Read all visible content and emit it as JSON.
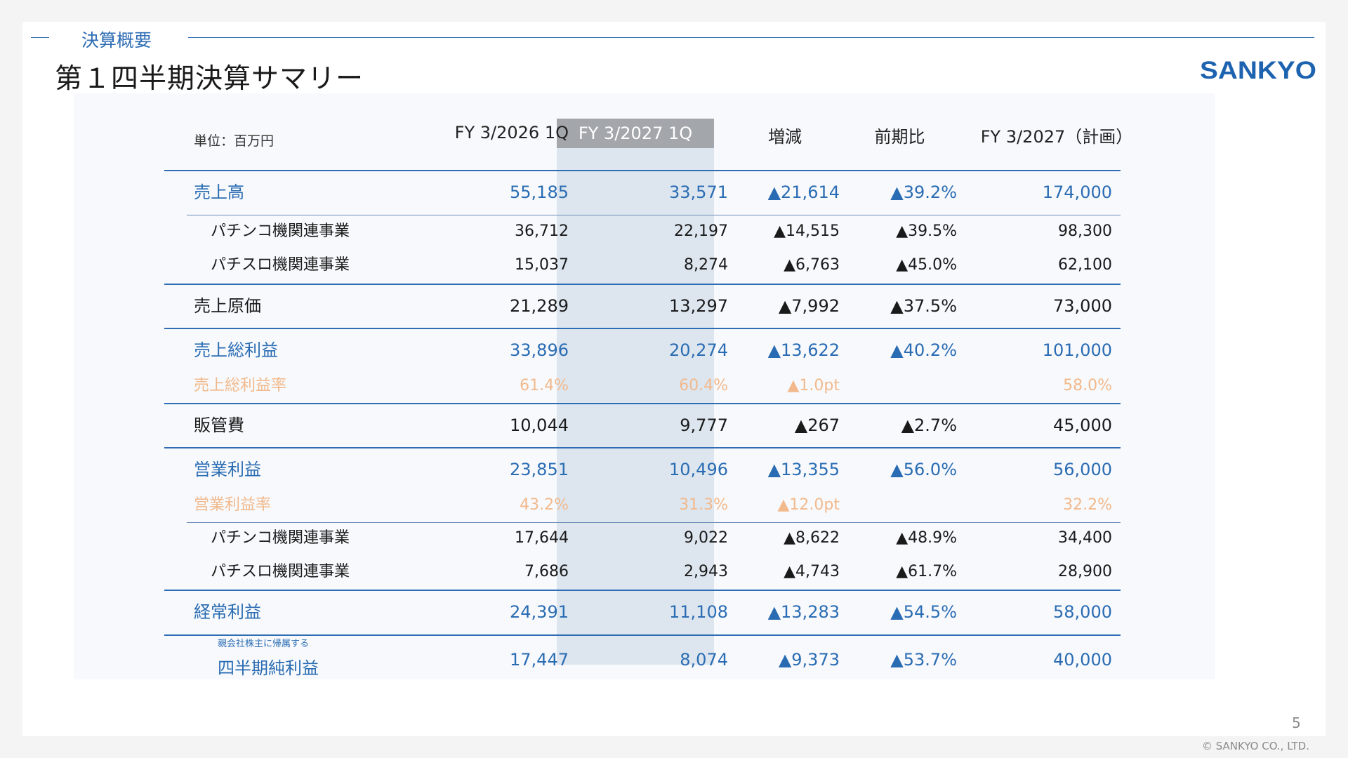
{
  "section_label": "決算概要",
  "page_title": "第１四半期決算サマリー",
  "logo_text": "SANKYO",
  "unit_label": "単位：百万円",
  "columns": [
    "FY 3/2026 1Q",
    "FY 3/2027 1Q",
    "増減",
    "前期比",
    "FY 3/2027（計画）"
  ],
  "rows": [
    {
      "label": "売上高",
      "c1": "55,185",
      "c2": "33,571",
      "c3": "▲21,614",
      "c4": "▲39.2%",
      "c5": "174,000"
    },
    {
      "label": "パチンコ機関連事業",
      "c1": "36,712",
      "c2": "22,197",
      "c3": "▲14,515",
      "c4": "▲39.5%",
      "c5": "98,300"
    },
    {
      "label": "パチスロ機関連事業",
      "c1": "15,037",
      "c2": "8,274",
      "c3": "▲6,763",
      "c4": "▲45.0%",
      "c5": "62,100"
    },
    {
      "label": "売上原価",
      "c1": "21,289",
      "c2": "13,297",
      "c3": "▲7,992",
      "c4": "▲37.5%",
      "c5": "73,000"
    },
    {
      "label": "売上総利益",
      "c1": "33,896",
      "c2": "20,274",
      "c3": "▲13,622",
      "c4": "▲40.2%",
      "c5": "101,000"
    },
    {
      "label": "売上総利益率",
      "c1": "61.4%",
      "c2": "60.4%",
      "c3": "▲1.0pt",
      "c4": "",
      "c5": "58.0%"
    },
    {
      "label": "販管費",
      "c1": "10,044",
      "c2": "9,777",
      "c3": "▲267",
      "c4": "▲2.7%",
      "c5": "45,000"
    },
    {
      "label": "営業利益",
      "c1": "23,851",
      "c2": "10,496",
      "c3": "▲13,355",
      "c4": "▲56.0%",
      "c5": "56,000"
    },
    {
      "label": "営業利益率",
      "c1": "43.2%",
      "c2": "31.3%",
      "c3": "▲12.0pt",
      "c4": "",
      "c5": "32.2%"
    },
    {
      "label": "パチンコ機関連事業",
      "c1": "17,644",
      "c2": "9,022",
      "c3": "▲8,622",
      "c4": "▲48.9%",
      "c5": "34,400"
    },
    {
      "label": "パチスロ機関連事業",
      "c1": "7,686",
      "c2": "2,943",
      "c3": "▲4,743",
      "c4": "▲61.7%",
      "c5": "28,900"
    },
    {
      "label": "経常利益",
      "c1": "24,391",
      "c2": "11,108",
      "c3": "▲13,283",
      "c4": "▲54.5%",
      "c5": "58,000"
    },
    {
      "label": "四半期純利益",
      "label_small": "親会社株主に帰属する",
      "c1": "17,447",
      "c2": "8,074",
      "c3": "▲9,373",
      "c4": "▲53.7%",
      "c5": "40,000"
    }
  ],
  "page_number": "5",
  "copyright": "© SANKYO CO., LTD.",
  "colors": {
    "accent_blue": "#2a6cb3",
    "margin_orange": "#f2b98c",
    "highlight_col": "#dde6ef",
    "highlight_head": "#a3a6ab"
  }
}
